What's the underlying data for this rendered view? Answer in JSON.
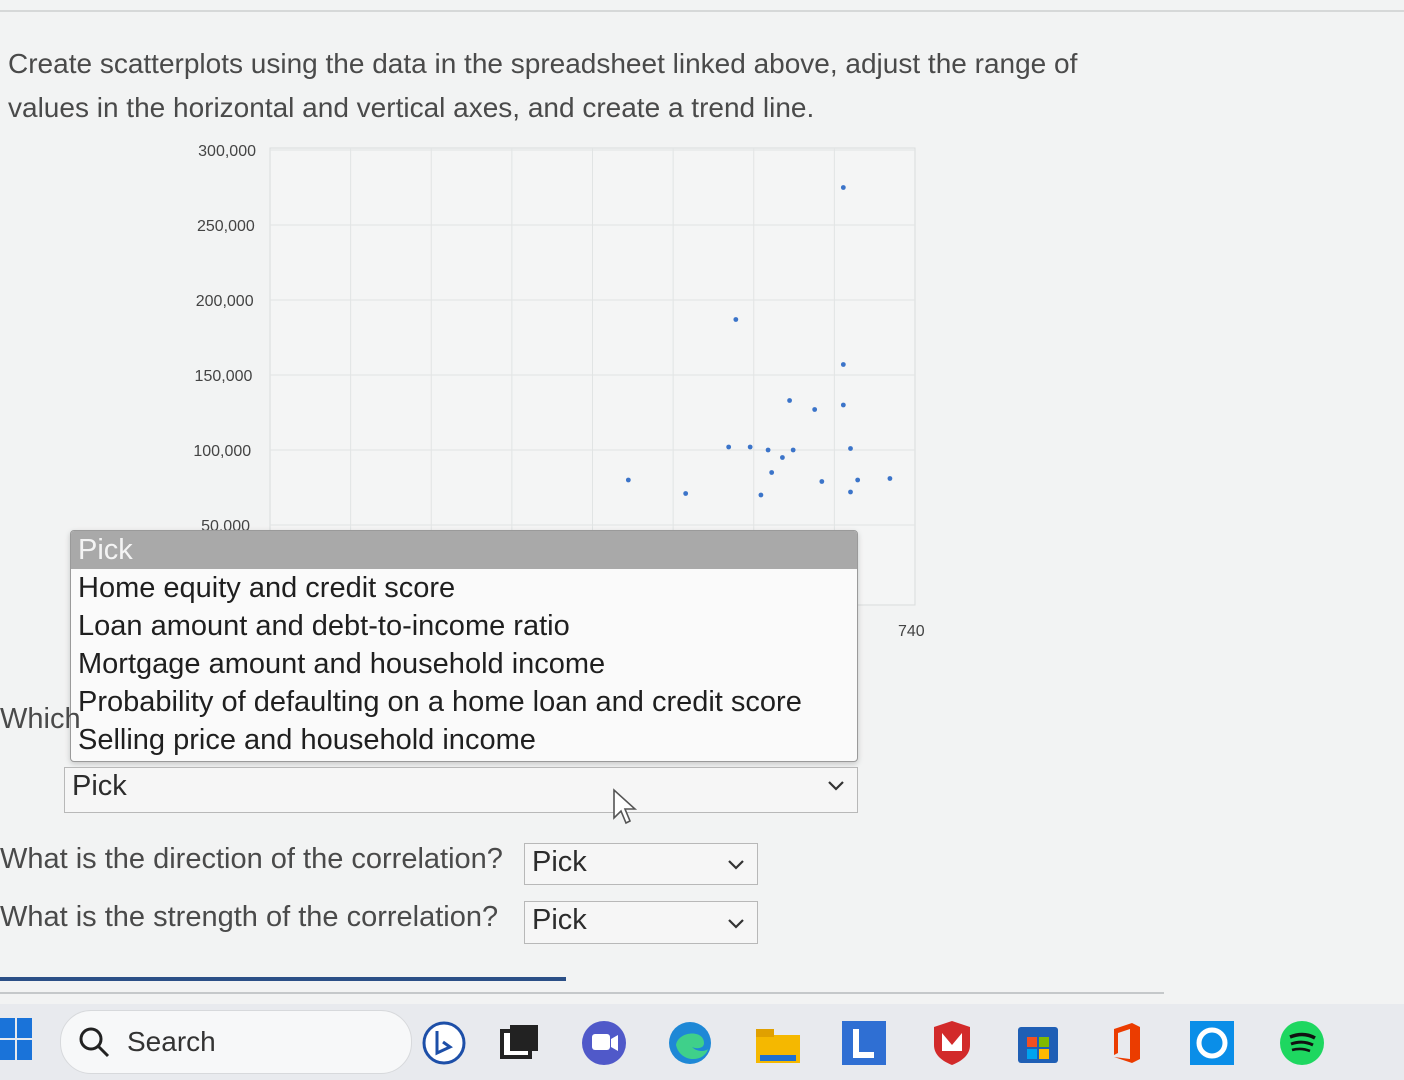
{
  "instructions": {
    "line1": "Create scatterplots using the data in the spreadsheet linked above, adjust the range of",
    "line2": "values in the horizontal and vertical axes, and create a trend line."
  },
  "chart_data": {
    "type": "scatter",
    "y_ticks": [
      "300,000",
      "250,000",
      "200,000",
      "150,000",
      "100,000",
      "50,000"
    ],
    "x_tick": "740",
    "ylim": [
      50000,
      300000
    ],
    "grid": true,
    "color": "#3b74c9",
    "points": [
      {
        "x": 720,
        "y": 275000
      },
      {
        "x": 690,
        "y": 187000
      },
      {
        "x": 720,
        "y": 157000
      },
      {
        "x": 705,
        "y": 133000
      },
      {
        "x": 712,
        "y": 127000
      },
      {
        "x": 720,
        "y": 130000
      },
      {
        "x": 688,
        "y": 102000
      },
      {
        "x": 694,
        "y": 102000
      },
      {
        "x": 699,
        "y": 100000
      },
      {
        "x": 703,
        "y": 95000
      },
      {
        "x": 706,
        "y": 100000
      },
      {
        "x": 722,
        "y": 101000
      },
      {
        "x": 700,
        "y": 85000
      },
      {
        "x": 714,
        "y": 79000
      },
      {
        "x": 724,
        "y": 80000
      },
      {
        "x": 733,
        "y": 81000
      },
      {
        "x": 660,
        "y": 80000
      },
      {
        "x": 676,
        "y": 71000
      },
      {
        "x": 722,
        "y": 72000
      },
      {
        "x": 697,
        "y": 70000
      }
    ]
  },
  "dropdown_list": {
    "options": [
      "Pick",
      "Home equity and credit score",
      "Loan amount and debt-to-income ratio",
      "Mortgage amount and household income",
      "Probability of defaulting on a home loan and credit score",
      "Selling price and household income"
    ],
    "selected_index": 0
  },
  "q1": {
    "label": "Which",
    "value": "Pick"
  },
  "q2": {
    "label": "What is the direction of the correlation?",
    "value": "Pick"
  },
  "q3": {
    "label": "What is the strength of the correlation?",
    "value": "Pick"
  },
  "taskbar": {
    "search_label": "Search",
    "icons": [
      "windows-start-icon",
      "search-icon",
      "bing-icon",
      "task-view-icon",
      "teams-chat-icon",
      "edge-icon",
      "file-explorer-icon",
      "l-app-icon",
      "mcafee-icon",
      "microsoft-store-icon",
      "office-icon",
      "cortana-icon",
      "spotify-icon"
    ]
  }
}
